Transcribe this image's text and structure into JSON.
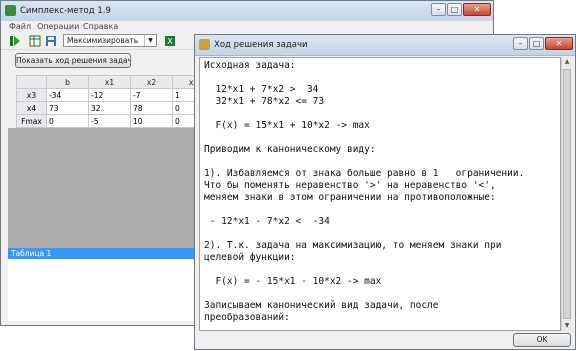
{
  "main_window": {
    "title": "Симплекс-метод 1.9",
    "menu": [
      "Файл",
      "Операции",
      "Справка"
    ],
    "combo_value": "Максимизировать",
    "show_button_label": "Показать ход решения задачи",
    "grid": {
      "headers": [
        "",
        "b",
        "x1",
        "x2",
        "x3"
      ],
      "rows": [
        [
          "x3",
          "-34",
          "-12",
          "-7",
          "1"
        ],
        [
          "x4",
          "73",
          "32",
          "78",
          "0"
        ],
        [
          "Fmax",
          "0",
          "-5",
          "10",
          "0"
        ]
      ]
    },
    "panel_label": "Таблица 1"
  },
  "solution_window": {
    "title": "Ход решения задачи",
    "lines": [
      "Исходная задача:",
      "",
      "  12*x1 + 7*x2 >  34",
      "  32*x1 + 78*x2 <= 73",
      "",
      "  F(x) = 15*x1 + 10*x2 -> max",
      "",
      "Приводим к каноническому виду:",
      "",
      "1). Избавляемся от знака больше равно в 1   ограничении.",
      "Что бы поменять неравенство '>' на неравенство '<',",
      "меняем знаки в этом ограничении на противоположные:",
      "",
      " - 12*x1 - 7*x2 <  -34",
      "",
      "2). Т.к. задача на максимизацию, то меняем знаки при",
      "целевой функции:",
      "",
      "  F(x) = - 15*x1 - 10*x2 -> max",
      "",
      "Записываем канонический вид задачи, после",
      "преобразований:"
    ],
    "ok_label": "OK"
  }
}
